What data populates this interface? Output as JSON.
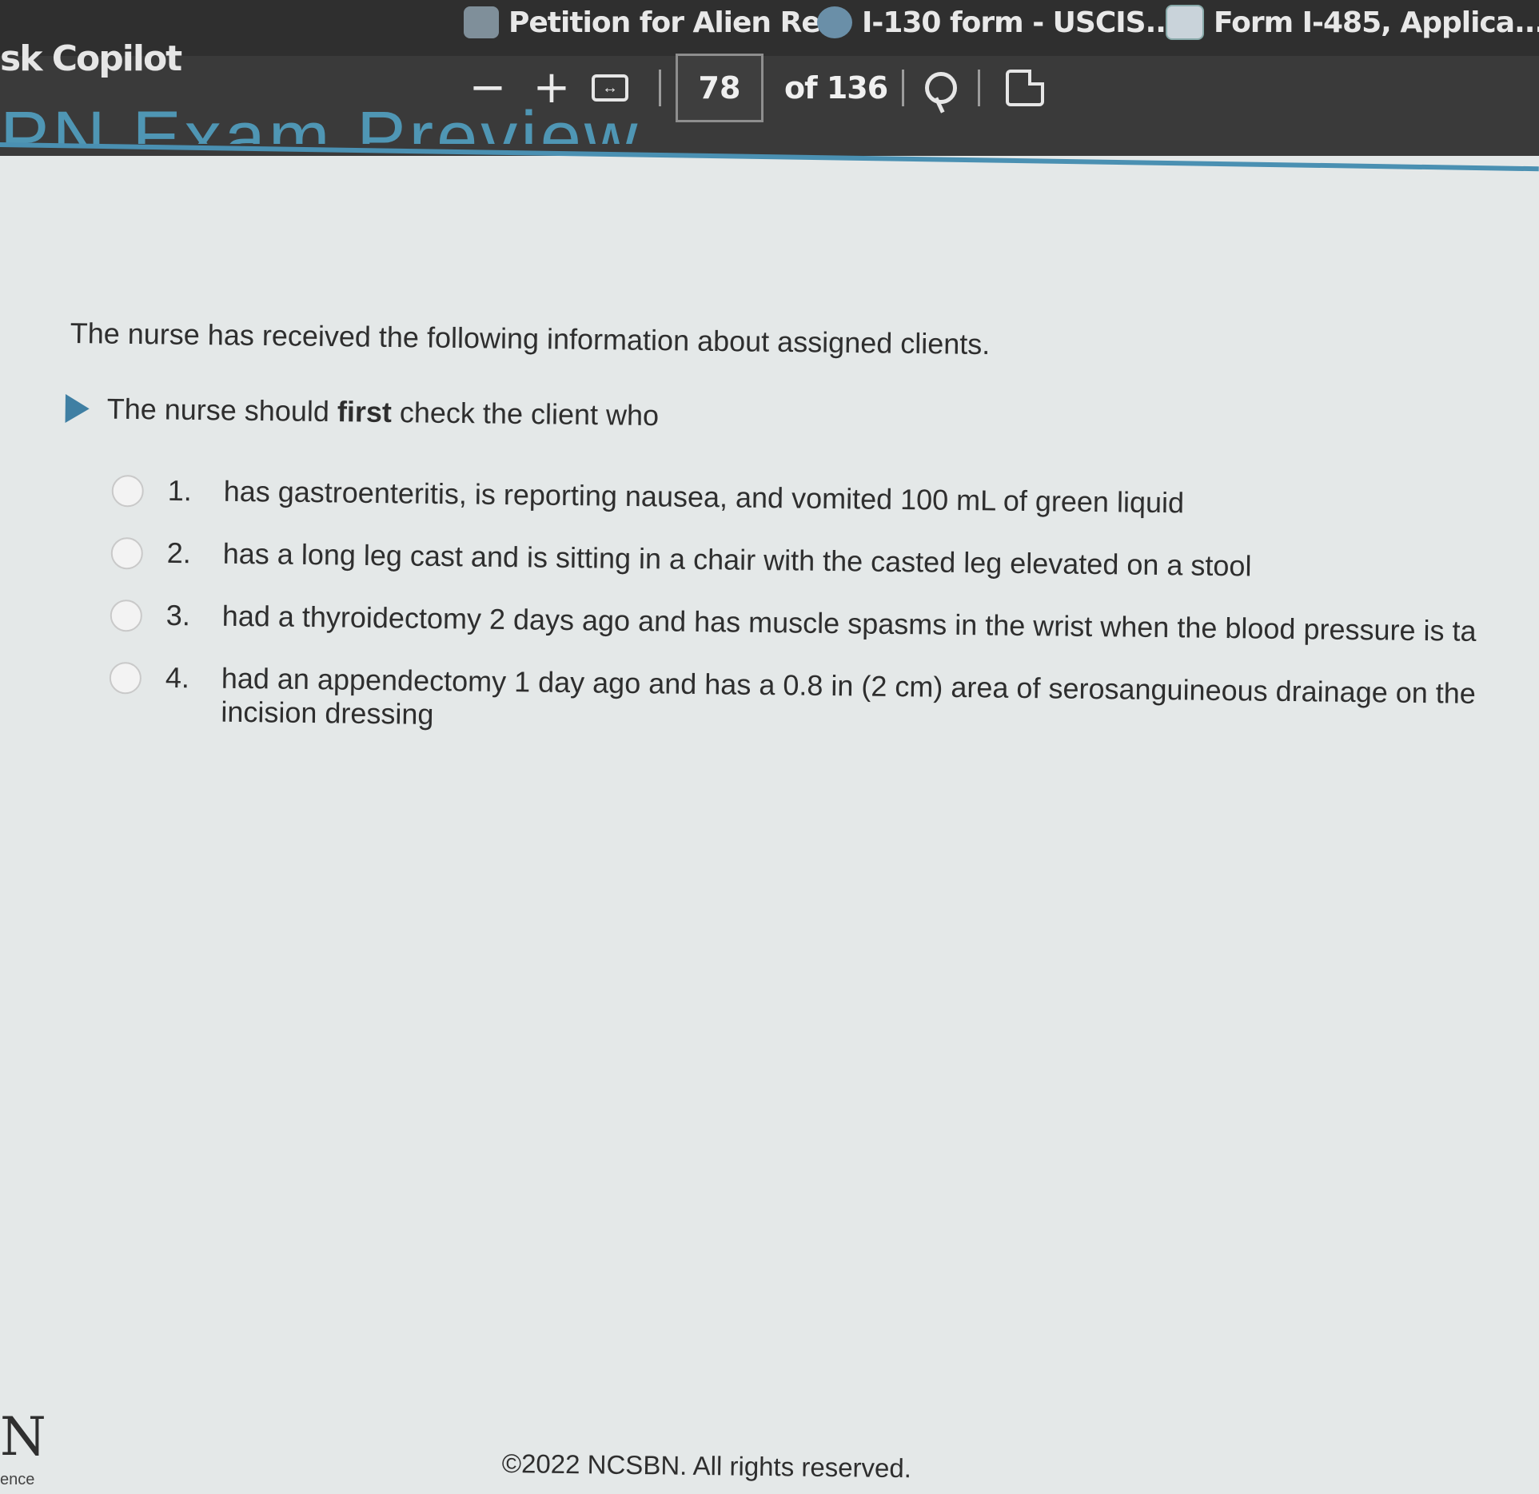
{
  "browser": {
    "tabs": [
      {
        "label": "Petition for Alien Re...",
        "icon": "document-icon"
      },
      {
        "label": "I-130 form - USCIS....",
        "icon": "uscis-seal-icon"
      },
      {
        "label": "Form I-485, Applica...",
        "icon": "edge-page-icon"
      }
    ],
    "app_title": "sk Copilot"
  },
  "pdf_toolbar": {
    "zoom_out": "−",
    "zoom_in": "+",
    "current_page": "78",
    "page_of": "of 136"
  },
  "exam": {
    "title": "PN Exam Preview"
  },
  "question": {
    "stem": "The nurse has received the following information about assigned clients.",
    "prompt_before": "The nurse should ",
    "prompt_bold": "first",
    "prompt_after": " check the client who",
    "options": [
      {
        "number": "1.",
        "text": "has gastroenteritis, is reporting nausea, and vomited 100 mL of green liquid"
      },
      {
        "number": "2.",
        "text": "has a long leg cast and is sitting in a chair with the casted leg elevated on a stool"
      },
      {
        "number": "3.",
        "text": "had a thyroidectomy 2 days ago and has muscle spasms in the wrist when the blood pressure is ta"
      },
      {
        "number": "4.",
        "text": "had an appendectomy 1 day ago and has a 0.8 in (2 cm) area of serosanguineous drainage on the incision dressing"
      }
    ]
  },
  "footer": {
    "copyright": "©2022 NCSBN. All rights reserved.",
    "logo_letter": "N",
    "logo_word": "ence"
  },
  "colors": {
    "chrome_bg": "#3a3a3a",
    "accent": "#4a90b2",
    "page_bg": "#e4e8e8"
  }
}
